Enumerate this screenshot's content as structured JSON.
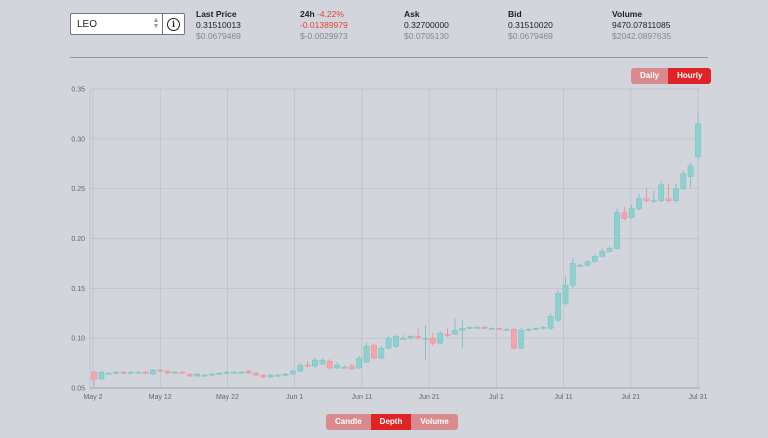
{
  "market": {
    "selected": "LEO"
  },
  "stats": {
    "last_price": {
      "label": "Last Price",
      "value": "0.31510013",
      "usd": "$0.0679469"
    },
    "change_24h": {
      "label": "24h",
      "pct": "-4.22%",
      "value": "-0.01389979",
      "usd": "$-0.0029973"
    },
    "ask": {
      "label": "Ask",
      "value": "0.32700000",
      "usd": "$0.0705130"
    },
    "bid": {
      "label": "Bid",
      "value": "0.31510020",
      "usd": "$0.0679469"
    },
    "volume": {
      "label": "Volume",
      "value": "9470.07811085",
      "usd": "$2042.0897635"
    }
  },
  "interval_buttons": {
    "daily": "Daily",
    "hourly": "Hourly",
    "active": "hourly"
  },
  "view_buttons": {
    "candle": "Candle",
    "depth": "Depth",
    "volume": "Volume",
    "active": "depth"
  },
  "colors": {
    "up": "#8ed0cf",
    "down": "#f4a4aa",
    "accent": "#e02426"
  },
  "chart_data": {
    "type": "candlestick",
    "ylim": [
      0.05,
      0.35
    ],
    "y_ticks": [
      "0.35",
      "0.30",
      "0.25",
      "0.20",
      "0.15",
      "0.10",
      "0.05"
    ],
    "x_ticks": [
      "May 2",
      "May 12",
      "May 22",
      "Jun 1",
      "Jun 11",
      "Jun 21",
      "Jul 1",
      "Jul 11",
      "Jul 21",
      "Jul 31"
    ],
    "grid": true,
    "candles": [
      [
        0.066,
        0.059,
        0.067,
        0.052
      ],
      [
        0.059,
        0.066,
        0.067,
        0.058
      ],
      [
        0.065,
        0.065,
        0.066,
        0.064
      ],
      [
        0.065,
        0.066,
        0.067,
        0.064
      ],
      [
        0.066,
        0.065,
        0.067,
        0.064
      ],
      [
        0.065,
        0.066,
        0.067,
        0.064
      ],
      [
        0.066,
        0.066,
        0.067,
        0.065
      ],
      [
        0.066,
        0.065,
        0.067,
        0.064
      ],
      [
        0.064,
        0.068,
        0.069,
        0.063
      ],
      [
        0.068,
        0.067,
        0.069,
        0.066
      ],
      [
        0.067,
        0.065,
        0.068,
        0.064
      ],
      [
        0.065,
        0.066,
        0.067,
        0.065
      ],
      [
        0.066,
        0.065,
        0.067,
        0.064
      ],
      [
        0.064,
        0.062,
        0.065,
        0.061
      ],
      [
        0.062,
        0.064,
        0.065,
        0.061
      ],
      [
        0.063,
        0.063,
        0.064,
        0.062
      ],
      [
        0.063,
        0.064,
        0.065,
        0.062
      ],
      [
        0.064,
        0.065,
        0.066,
        0.063
      ],
      [
        0.065,
        0.066,
        0.067,
        0.064
      ],
      [
        0.066,
        0.066,
        0.067,
        0.065
      ],
      [
        0.066,
        0.066,
        0.067,
        0.065
      ],
      [
        0.067,
        0.065,
        0.068,
        0.064
      ],
      [
        0.065,
        0.063,
        0.066,
        0.062
      ],
      [
        0.063,
        0.061,
        0.064,
        0.06
      ],
      [
        0.061,
        0.063,
        0.064,
        0.06
      ],
      [
        0.063,
        0.063,
        0.064,
        0.062
      ],
      [
        0.063,
        0.064,
        0.065,
        0.062
      ],
      [
        0.064,
        0.067,
        0.068,
        0.063
      ],
      [
        0.067,
        0.073,
        0.075,
        0.066
      ],
      [
        0.073,
        0.072,
        0.077,
        0.071
      ],
      [
        0.072,
        0.078,
        0.08,
        0.07
      ],
      [
        0.074,
        0.078,
        0.08,
        0.073
      ],
      [
        0.077,
        0.07,
        0.079,
        0.069
      ],
      [
        0.07,
        0.073,
        0.076,
        0.069
      ],
      [
        0.071,
        0.071,
        0.073,
        0.07
      ],
      [
        0.072,
        0.069,
        0.074,
        0.068
      ],
      [
        0.07,
        0.08,
        0.082,
        0.069
      ],
      [
        0.076,
        0.092,
        0.095,
        0.075
      ],
      [
        0.093,
        0.08,
        0.095,
        0.079
      ],
      [
        0.08,
        0.09,
        0.092,
        0.079
      ],
      [
        0.09,
        0.1,
        0.102,
        0.089
      ],
      [
        0.092,
        0.102,
        0.104,
        0.09
      ],
      [
        0.1,
        0.1,
        0.103,
        0.099
      ],
      [
        0.1,
        0.102,
        0.103,
        0.099
      ],
      [
        0.102,
        0.1,
        0.11,
        0.099
      ],
      [
        0.1,
        0.1,
        0.113,
        0.078
      ],
      [
        0.1,
        0.095,
        0.105,
        0.092
      ],
      [
        0.095,
        0.105,
        0.107,
        0.094
      ],
      [
        0.104,
        0.103,
        0.11,
        0.101
      ],
      [
        0.104,
        0.108,
        0.12,
        0.103
      ],
      [
        0.108,
        0.11,
        0.118,
        0.09
      ],
      [
        0.11,
        0.111,
        0.112,
        0.109
      ],
      [
        0.111,
        0.111,
        0.112,
        0.11
      ],
      [
        0.111,
        0.11,
        0.112,
        0.109
      ],
      [
        0.11,
        0.11,
        0.111,
        0.109
      ],
      [
        0.11,
        0.109,
        0.111,
        0.108
      ],
      [
        0.109,
        0.109,
        0.11,
        0.108
      ],
      [
        0.109,
        0.09,
        0.11,
        0.089
      ],
      [
        0.09,
        0.108,
        0.11,
        0.089
      ],
      [
        0.108,
        0.109,
        0.11,
        0.107
      ],
      [
        0.109,
        0.11,
        0.111,
        0.108
      ],
      [
        0.11,
        0.111,
        0.112,
        0.109
      ],
      [
        0.11,
        0.122,
        0.125,
        0.108
      ],
      [
        0.118,
        0.145,
        0.148,
        0.116
      ],
      [
        0.135,
        0.153,
        0.162,
        0.133
      ],
      [
        0.153,
        0.175,
        0.18,
        0.15
      ],
      [
        0.173,
        0.173,
        0.175,
        0.172
      ],
      [
        0.173,
        0.177,
        0.178,
        0.172
      ],
      [
        0.177,
        0.182,
        0.184,
        0.176
      ],
      [
        0.182,
        0.187,
        0.19,
        0.181
      ],
      [
        0.187,
        0.19,
        0.192,
        0.186
      ],
      [
        0.19,
        0.226,
        0.23,
        0.189
      ],
      [
        0.226,
        0.22,
        0.232,
        0.218
      ],
      [
        0.221,
        0.23,
        0.234,
        0.22
      ],
      [
        0.23,
        0.24,
        0.245,
        0.228
      ],
      [
        0.24,
        0.238,
        0.25,
        0.236
      ],
      [
        0.238,
        0.238,
        0.248,
        0.236
      ],
      [
        0.238,
        0.254,
        0.258,
        0.236
      ],
      [
        0.24,
        0.238,
        0.255,
        0.236
      ],
      [
        0.238,
        0.25,
        0.255,
        0.236
      ],
      [
        0.25,
        0.265,
        0.268,
        0.248
      ],
      [
        0.262,
        0.273,
        0.276,
        0.251
      ],
      [
        0.282,
        0.315,
        0.327,
        0.279
      ]
    ]
  }
}
